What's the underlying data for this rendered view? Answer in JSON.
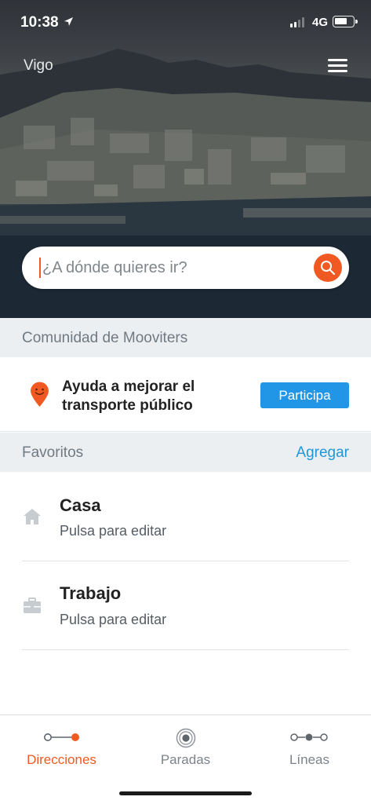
{
  "status_bar": {
    "time": "10:38",
    "network": "4G"
  },
  "header": {
    "city": "Vigo"
  },
  "search": {
    "placeholder": "¿A dónde quieres ir?"
  },
  "community": {
    "title": "Comunidad de Mooviters",
    "message": "Ayuda a mejorar el transporte público",
    "button_label": "Participa"
  },
  "favorites": {
    "title": "Favoritos",
    "add_label": "Agregar",
    "items": [
      {
        "title": "Casa",
        "subtitle": "Pulsa para editar",
        "icon": "home-icon"
      },
      {
        "title": "Trabajo",
        "subtitle": "Pulsa para editar",
        "icon": "briefcase-icon"
      }
    ]
  },
  "bottom_nav": {
    "items": [
      {
        "label": "Direcciones",
        "icon": "directions-icon",
        "active": true
      },
      {
        "label": "Paradas",
        "icon": "stop-icon",
        "active": false
      },
      {
        "label": "Líneas",
        "icon": "lines-icon",
        "active": false
      }
    ]
  },
  "colors": {
    "accent": "#f05a22",
    "link": "#2196d9",
    "button": "#2196e6",
    "section_bg": "#eceff1"
  }
}
